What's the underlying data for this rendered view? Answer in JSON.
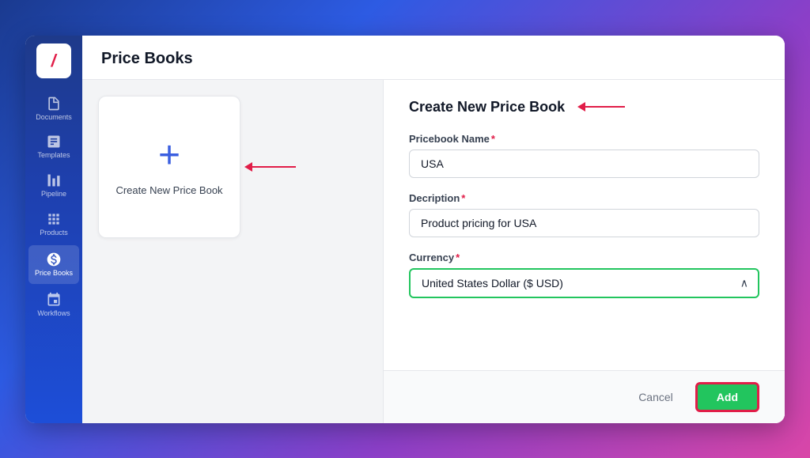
{
  "app": {
    "logo_slash": "/",
    "title": "Price Books"
  },
  "sidebar": {
    "items": [
      {
        "id": "documents",
        "label": "Documents",
        "icon": "document"
      },
      {
        "id": "templates",
        "label": "Templates",
        "icon": "template"
      },
      {
        "id": "pipeline",
        "label": "Pipeline",
        "icon": "pipeline"
      },
      {
        "id": "products",
        "label": "Products",
        "icon": "products"
      },
      {
        "id": "price-books",
        "label": "Price Books",
        "icon": "pricebooks",
        "active": true
      },
      {
        "id": "workflows",
        "label": "Workflows",
        "icon": "workflows"
      }
    ]
  },
  "price_books_header": "Price Books",
  "create_card": {
    "plus": "+",
    "label": "Create New Price Book"
  },
  "form": {
    "title": "Create New Price Book",
    "fields": {
      "name": {
        "label": "Pricebook Name",
        "required": true,
        "value": "USA"
      },
      "description": {
        "label": "Decription",
        "required": true,
        "value": "Product pricing for USA"
      },
      "currency": {
        "label": "Currency",
        "required": true,
        "value": "United States Dollar ($ USD)"
      }
    },
    "cancel_label": "Cancel",
    "add_label": "Add"
  }
}
